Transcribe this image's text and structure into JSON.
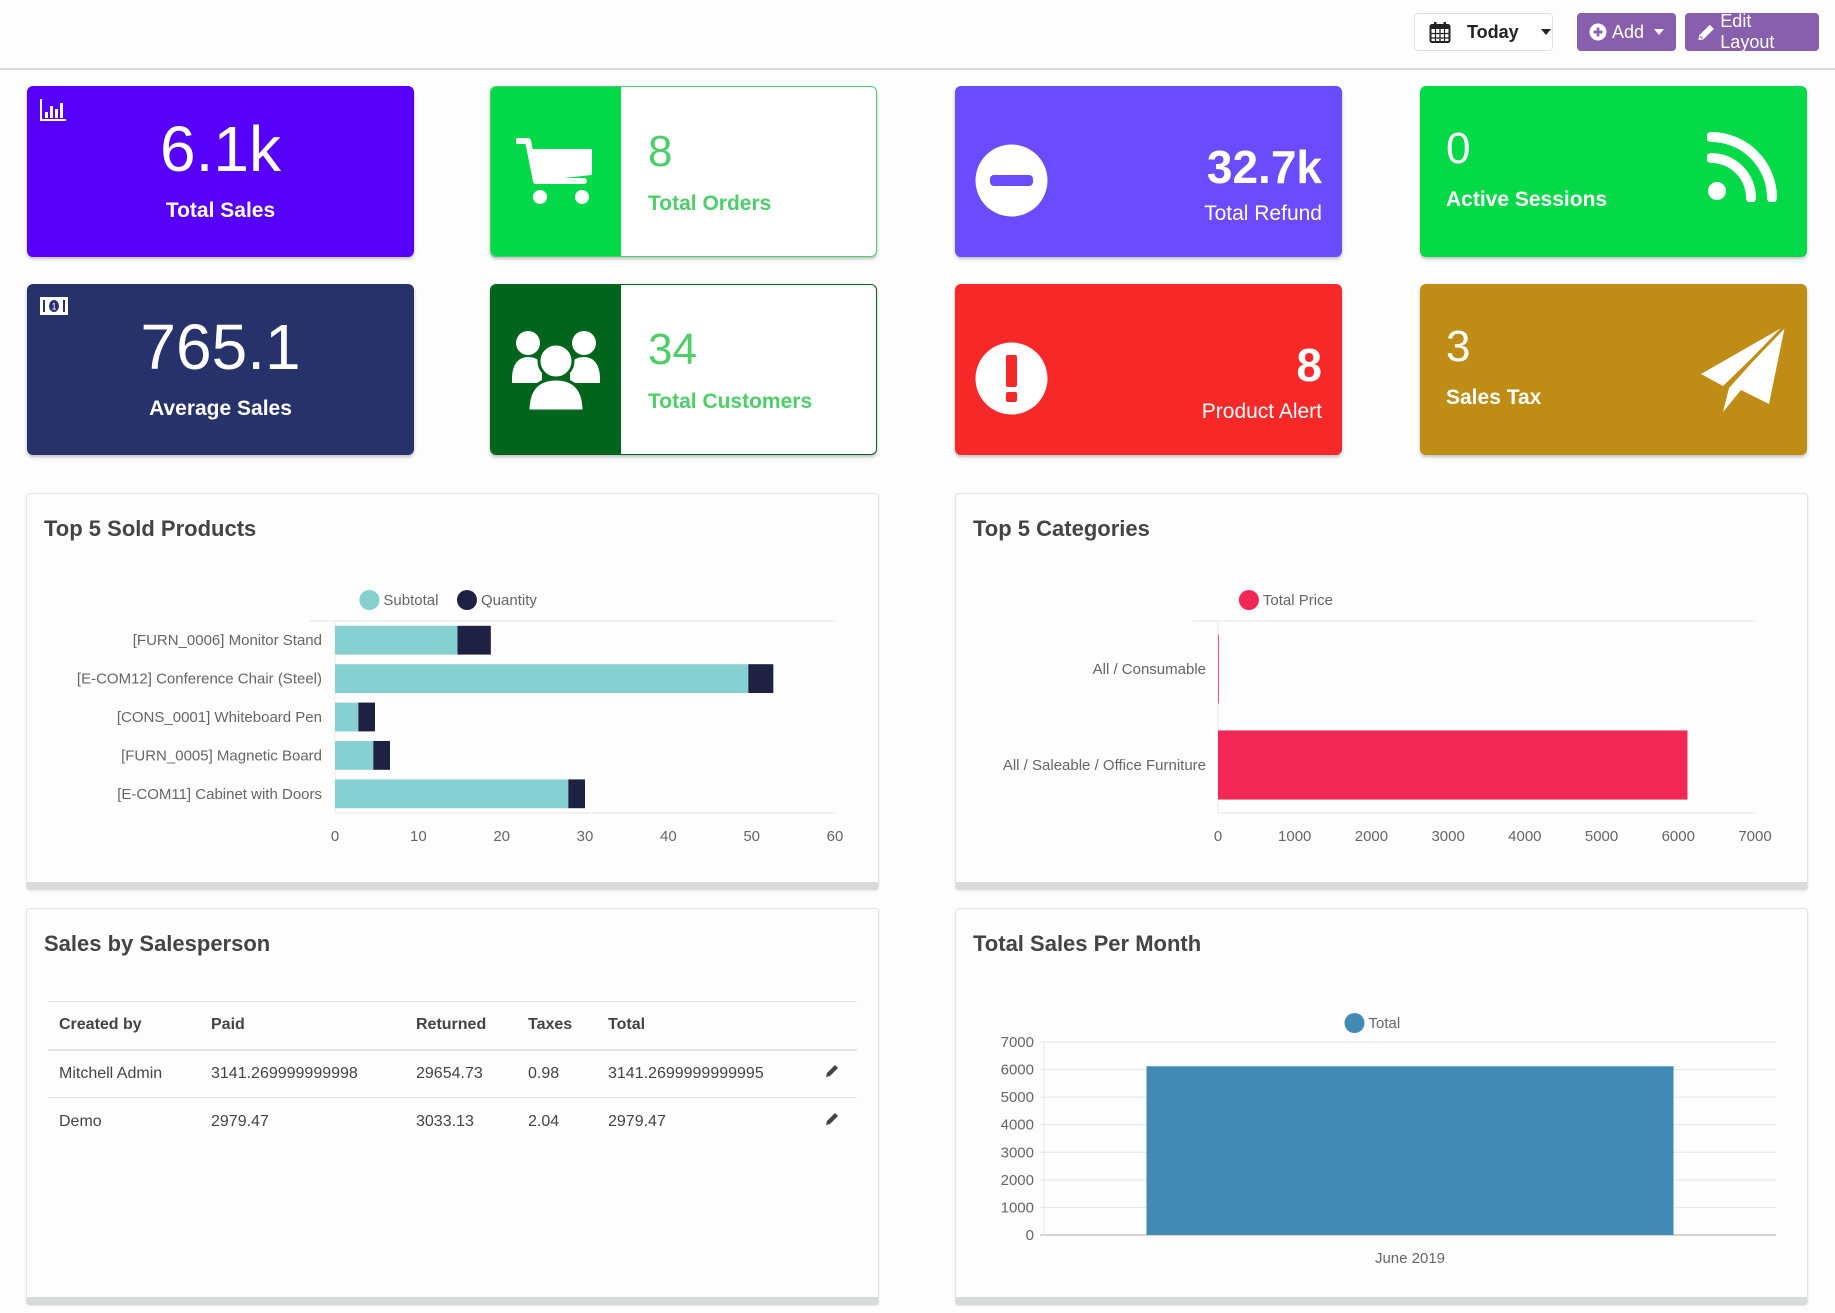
{
  "header": {
    "date_filter": {
      "label": "Today",
      "icon": "calendar-icon"
    },
    "add_button": {
      "label": "Add",
      "icon": "plus-circle-icon"
    },
    "edit_layout_button": {
      "label": "Edit Layout",
      "icon": "pencil-icon"
    }
  },
  "tiles": [
    {
      "value": "6.1k",
      "label": "Total Sales",
      "icon": "bar-chart-icon",
      "color": "#5600f9"
    },
    {
      "value": "8",
      "label": "Total Orders",
      "icon": "shopping-cart-icon",
      "color": "#03d848",
      "text_color": "#4ece68"
    },
    {
      "value": "32.7k",
      "label": "Total Refund",
      "icon": "minus-circle-icon",
      "color": "#6a4cfe"
    },
    {
      "value": "0",
      "label": "Active Sessions",
      "icon": "rss-icon",
      "color": "#04d948"
    },
    {
      "value": "765.1",
      "label": "Average Sales",
      "icon": "money-icon",
      "color": "#27326b"
    },
    {
      "value": "34",
      "label": "Total Customers",
      "icon": "users-icon",
      "color": "#02651c",
      "text_color": "#4ece68"
    },
    {
      "value": "8",
      "label": "Product Alert",
      "icon": "exclamation-circle-icon",
      "color": "#f72828"
    },
    {
      "value": "3",
      "label": "Sales Tax",
      "icon": "paper-plane-icon",
      "color": "#bf8c16"
    }
  ],
  "panels": {
    "top_products": {
      "title": "Top 5 Sold Products"
    },
    "top_categories": {
      "title": "Top 5 Categories"
    },
    "salesperson": {
      "title": "Sales by Salesperson",
      "columns": [
        "Created by",
        "Paid",
        "Returned",
        "Taxes",
        "Total"
      ],
      "rows": [
        [
          "Mitchell Admin",
          "3141.269999999998",
          "29654.73",
          "0.98",
          "3141.2699999999995"
        ],
        [
          "Demo",
          "2979.47",
          "3033.13",
          "2.04",
          "2979.47"
        ]
      ]
    },
    "sales_per_month": {
      "title": "Total Sales Per Month"
    }
  },
  "chart_data": [
    {
      "type": "bar",
      "orientation": "horizontal",
      "stacked": true,
      "title": "Top 5 Sold Products",
      "categories": [
        "[FURN_0006] Monitor Stand",
        "[E-COM12] Conference Chair (Steel)",
        "[CONS_0001] Whiteboard Pen",
        "[FURN_0005] Magnetic Board",
        "[E-COM11] Cabinet with Doors"
      ],
      "series": [
        {
          "name": "Subtotal",
          "color": "#87d0d1",
          "values": [
            14.7,
            49.6,
            2.8,
            4.6,
            28
          ]
        },
        {
          "name": "Quantity",
          "color": "#1f2142",
          "values": [
            4,
            3,
            2,
            2,
            2
          ]
        }
      ],
      "xlim": [
        0,
        60
      ],
      "xticks": [
        0,
        10,
        20,
        30,
        40,
        50,
        60
      ],
      "legend": "top-center",
      "grid": true
    },
    {
      "type": "bar",
      "orientation": "horizontal",
      "title": "Top 5 Categories",
      "categories": [
        "All / Consumable",
        "All / Saleable / Office Furniture"
      ],
      "series": [
        {
          "name": "Total Price",
          "color": "#f22756",
          "values": [
            10,
            6120
          ]
        }
      ],
      "xlim": [
        0,
        7000
      ],
      "xticks": [
        0,
        1000,
        2000,
        3000,
        4000,
        5000,
        6000,
        7000
      ],
      "legend": "top-center",
      "grid": true
    },
    {
      "type": "bar",
      "title": "Total Sales Per Month",
      "categories": [
        "June 2019"
      ],
      "series": [
        {
          "name": "Total",
          "color": "#428ab3",
          "values": [
            6120
          ]
        }
      ],
      "ylim": [
        0,
        7000
      ],
      "yticks": [
        0,
        1000,
        2000,
        3000,
        4000,
        5000,
        6000,
        7000
      ],
      "legend": "top-center",
      "grid": true
    }
  ]
}
